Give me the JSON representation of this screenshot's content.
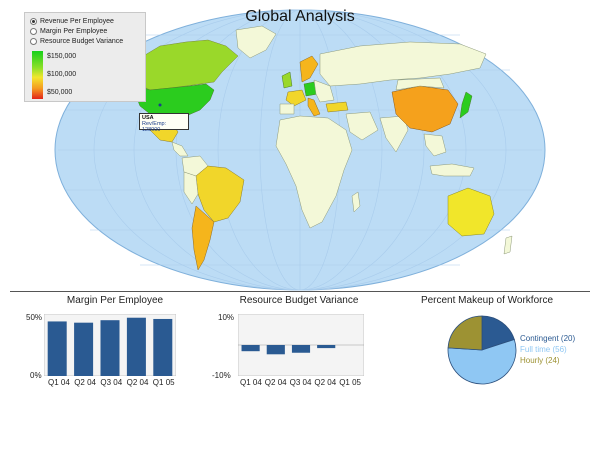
{
  "page": {
    "title": "Global Analysis"
  },
  "map_controls": {
    "options": [
      {
        "label": "Revenue Per Employee",
        "selected": true
      },
      {
        "label": "Margin Per Employee",
        "selected": false
      },
      {
        "label": "Resource Budget Variance",
        "selected": false
      }
    ],
    "legend": [
      "$150,000",
      "$100,000",
      "$50,000"
    ]
  },
  "tooltip": {
    "title": "USA",
    "value": "Rev/Emp: 128000"
  },
  "colors": {
    "ocean": "#bcdcf5",
    "land": "#f3f8d8",
    "high": "#2bcc1e",
    "mid": "#9ad82a",
    "yellow": "#f1d62a",
    "orange": "#f5a11c",
    "bar": "#2a5a92",
    "contingent": "#2b5a92",
    "fulltime": "#8fc7f3",
    "hourly": "#9d9233"
  },
  "chart_data": [
    {
      "type": "bar",
      "title": "Margin Per Employee",
      "categories": [
        "Q1 04",
        "Q2 04",
        "Q3 04",
        "Q2 04",
        "Q1 05"
      ],
      "values": [
        44,
        43,
        45,
        47,
        46
      ],
      "ylim": [
        0,
        50
      ],
      "ytick_labels": [
        "50%",
        "0%"
      ]
    },
    {
      "type": "bar",
      "title": "Resource Budget Variance",
      "categories": [
        "Q1 04",
        "Q2 04",
        "Q3 04",
        "Q2 04",
        "Q1 05"
      ],
      "values": [
        -2,
        -3,
        -2.5,
        -1,
        0
      ],
      "ylim": [
        -10,
        10
      ],
      "ytick_labels": [
        "10%",
        "-10%"
      ]
    },
    {
      "type": "pie",
      "title": "Percent Makeup of Workforce",
      "slices": [
        {
          "label": "Contingent (20)",
          "value": 20
        },
        {
          "label": "Full time (56)",
          "value": 56
        },
        {
          "label": "Hourly (24)",
          "value": 24
        }
      ]
    }
  ]
}
